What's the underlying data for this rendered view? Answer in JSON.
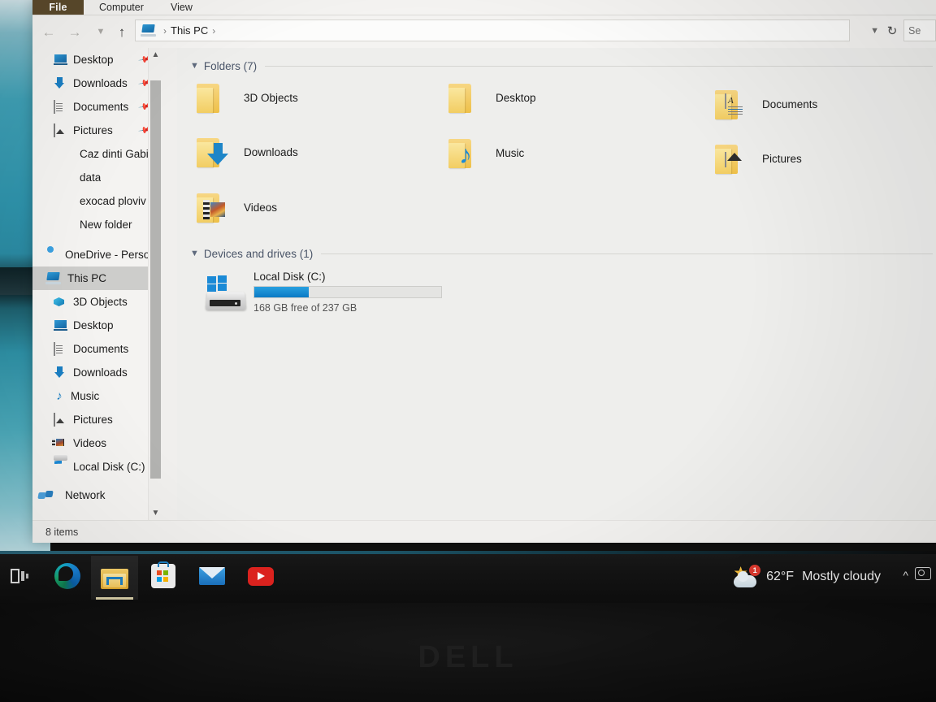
{
  "window": {
    "title": "This PC",
    "ribbon_tabs": [
      {
        "label": "File",
        "active": true
      },
      {
        "label": "Computer",
        "active": false
      },
      {
        "label": "View",
        "active": false
      }
    ],
    "nav": {
      "back_icon": "arrow-left-icon",
      "forward_icon": "arrow-right-icon",
      "recent_icon": "chevron-down-icon",
      "up_icon": "arrow-up-icon",
      "breadcrumb_icon": "this-pc-icon",
      "breadcrumb": "This PC",
      "separator": "›",
      "address_dropdown_icon": "chevron-down-icon",
      "refresh_icon": "refresh-icon",
      "search_value": "Se",
      "search_placeholder": "Search This PC"
    },
    "status": "8 items"
  },
  "sidebar": {
    "quick_access": [
      {
        "label": "Desktop",
        "icon": "desktop-icon",
        "pinned": true
      },
      {
        "label": "Downloads",
        "icon": "download-icon",
        "pinned": true
      },
      {
        "label": "Documents",
        "icon": "document-icon",
        "pinned": true
      },
      {
        "label": "Pictures",
        "icon": "picture-icon",
        "pinned": true
      },
      {
        "label": "Caz dinti Gabi",
        "icon": "folder-icon",
        "pinned": false
      },
      {
        "label": "data",
        "icon": "folder-icon",
        "pinned": false
      },
      {
        "label": "exocad ploviv",
        "icon": "folder-icon",
        "pinned": false
      },
      {
        "label": "New folder",
        "icon": "folder-icon",
        "pinned": false
      }
    ],
    "onedrive": {
      "label": "OneDrive - Person",
      "icon": "onedrive-icon"
    },
    "this_pc": {
      "label": "This PC",
      "icon": "this-pc-icon",
      "selected": true
    },
    "this_pc_children": [
      {
        "label": "3D Objects",
        "icon": "cube-icon"
      },
      {
        "label": "Desktop",
        "icon": "desktop-icon"
      },
      {
        "label": "Documents",
        "icon": "document-icon"
      },
      {
        "label": "Downloads",
        "icon": "download-icon"
      },
      {
        "label": "Music",
        "icon": "music-note-icon"
      },
      {
        "label": "Pictures",
        "icon": "picture-icon"
      },
      {
        "label": "Videos",
        "icon": "film-icon"
      },
      {
        "label": "Local Disk (C:)",
        "icon": "disk-icon"
      }
    ],
    "network": {
      "label": "Network",
      "icon": "network-icon"
    },
    "scrollbar": {
      "up_icon": "chevron-up-icon",
      "down_icon": "chevron-down-icon"
    }
  },
  "content": {
    "groups": [
      {
        "title": "Folders (7)",
        "chevron": "chevron-down-icon"
      },
      {
        "title": "Devices and drives (1)",
        "chevron": "chevron-down-icon"
      }
    ],
    "folders": [
      {
        "label": "3D Objects",
        "glyph": "cube-icon"
      },
      {
        "label": "Desktop",
        "glyph": "monitor-icon"
      },
      {
        "label": "Documents",
        "glyph": "document-file-icon"
      },
      {
        "label": "Downloads",
        "glyph": "download-arrow-icon"
      },
      {
        "label": "Music",
        "glyph": "music-note-icon"
      },
      {
        "label": "Pictures",
        "glyph": "photo-icon"
      },
      {
        "label": "Videos",
        "glyph": "film-icon"
      }
    ],
    "drives": [
      {
        "label": "Local Disk (C:)",
        "icon": "hard-disk-windows-icon",
        "free_text": "168 GB free of 237 GB",
        "free_gb": 168,
        "total_gb": 237,
        "used_percent": 29,
        "bar_color": "#0a7ac4"
      }
    ]
  },
  "taskbar": {
    "items": [
      {
        "name": "task-view",
        "icon": "task-view-icon",
        "active": false
      },
      {
        "name": "microsoft-edge",
        "icon": "edge-icon",
        "active": false
      },
      {
        "name": "file-explorer",
        "icon": "file-explorer-icon",
        "active": true
      },
      {
        "name": "microsoft-store",
        "icon": "microsoft-store-icon",
        "active": false
      },
      {
        "name": "mail",
        "icon": "mail-icon",
        "active": false
      },
      {
        "name": "youtube",
        "icon": "youtube-icon",
        "active": false
      }
    ],
    "weather": {
      "icon": "sun-cloud-icon",
      "badge": "1",
      "temperature": "62°F",
      "condition": "Mostly cloudy"
    },
    "tray": {
      "show_hidden_icon": "chevron-up-icon",
      "camera_icon": "camera-icon"
    }
  },
  "device": {
    "brand": "DELL"
  },
  "colors": {
    "accent": "#0a7ac4",
    "window_bg": "#f0efed",
    "content_bg": "#eeeeec",
    "selection": "#cdcdcb",
    "group_header": "#4a5568",
    "taskbar": "#141414",
    "file_tab": "#5b4a2c"
  }
}
